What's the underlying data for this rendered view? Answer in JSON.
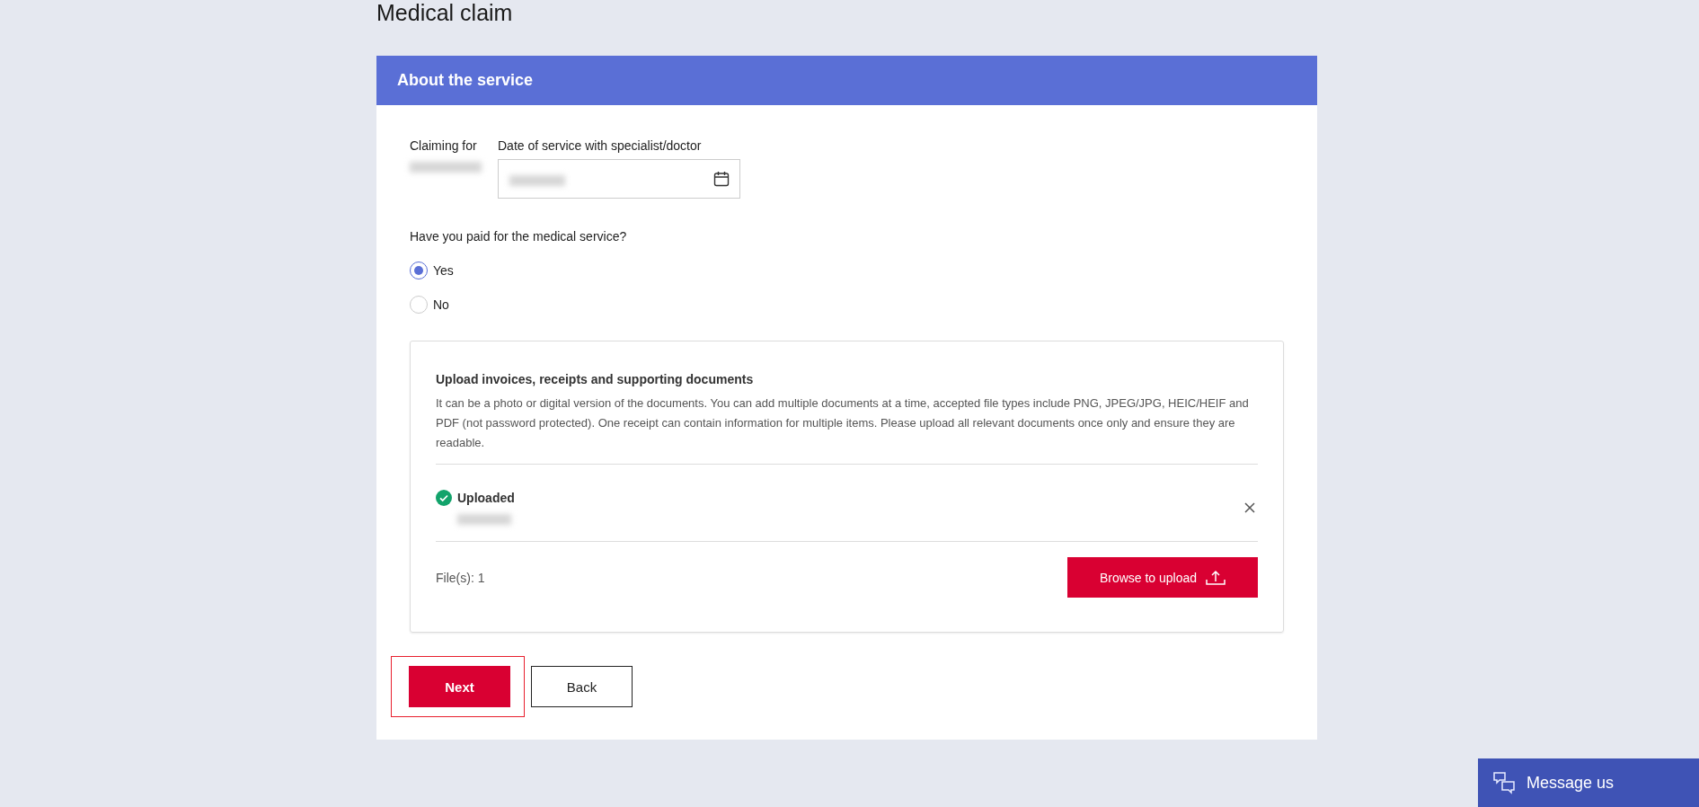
{
  "page_title": "Medical claim",
  "card": {
    "header": "About the service",
    "claiming_for": {
      "label": "Claiming for"
    },
    "date_field": {
      "label": "Date of service with specialist/doctor"
    },
    "question": "Have you paid for the medical service?",
    "options": [
      {
        "label": "Yes",
        "selected": true
      },
      {
        "label": "No",
        "selected": false
      }
    ],
    "upload": {
      "title": "Upload invoices, receipts and supporting documents",
      "description": "It can be a photo or digital version of the documents. You can add multiple documents at a time, accepted file types include PNG, JPEG/JPG, HEIC/HEIF and PDF (not password protected). One receipt can contain information for multiple items. Please upload all relevant documents once only and ensure they are readable.",
      "files": [
        {
          "status": "Uploaded"
        }
      ],
      "count": "File(s): 1",
      "browse_button": "Browse to upload"
    },
    "buttons": [
      {
        "label": "Next",
        "kind": "primary",
        "focused": true
      },
      {
        "label": "Back",
        "kind": "secondary"
      }
    ]
  },
  "message_button": "Message us"
}
